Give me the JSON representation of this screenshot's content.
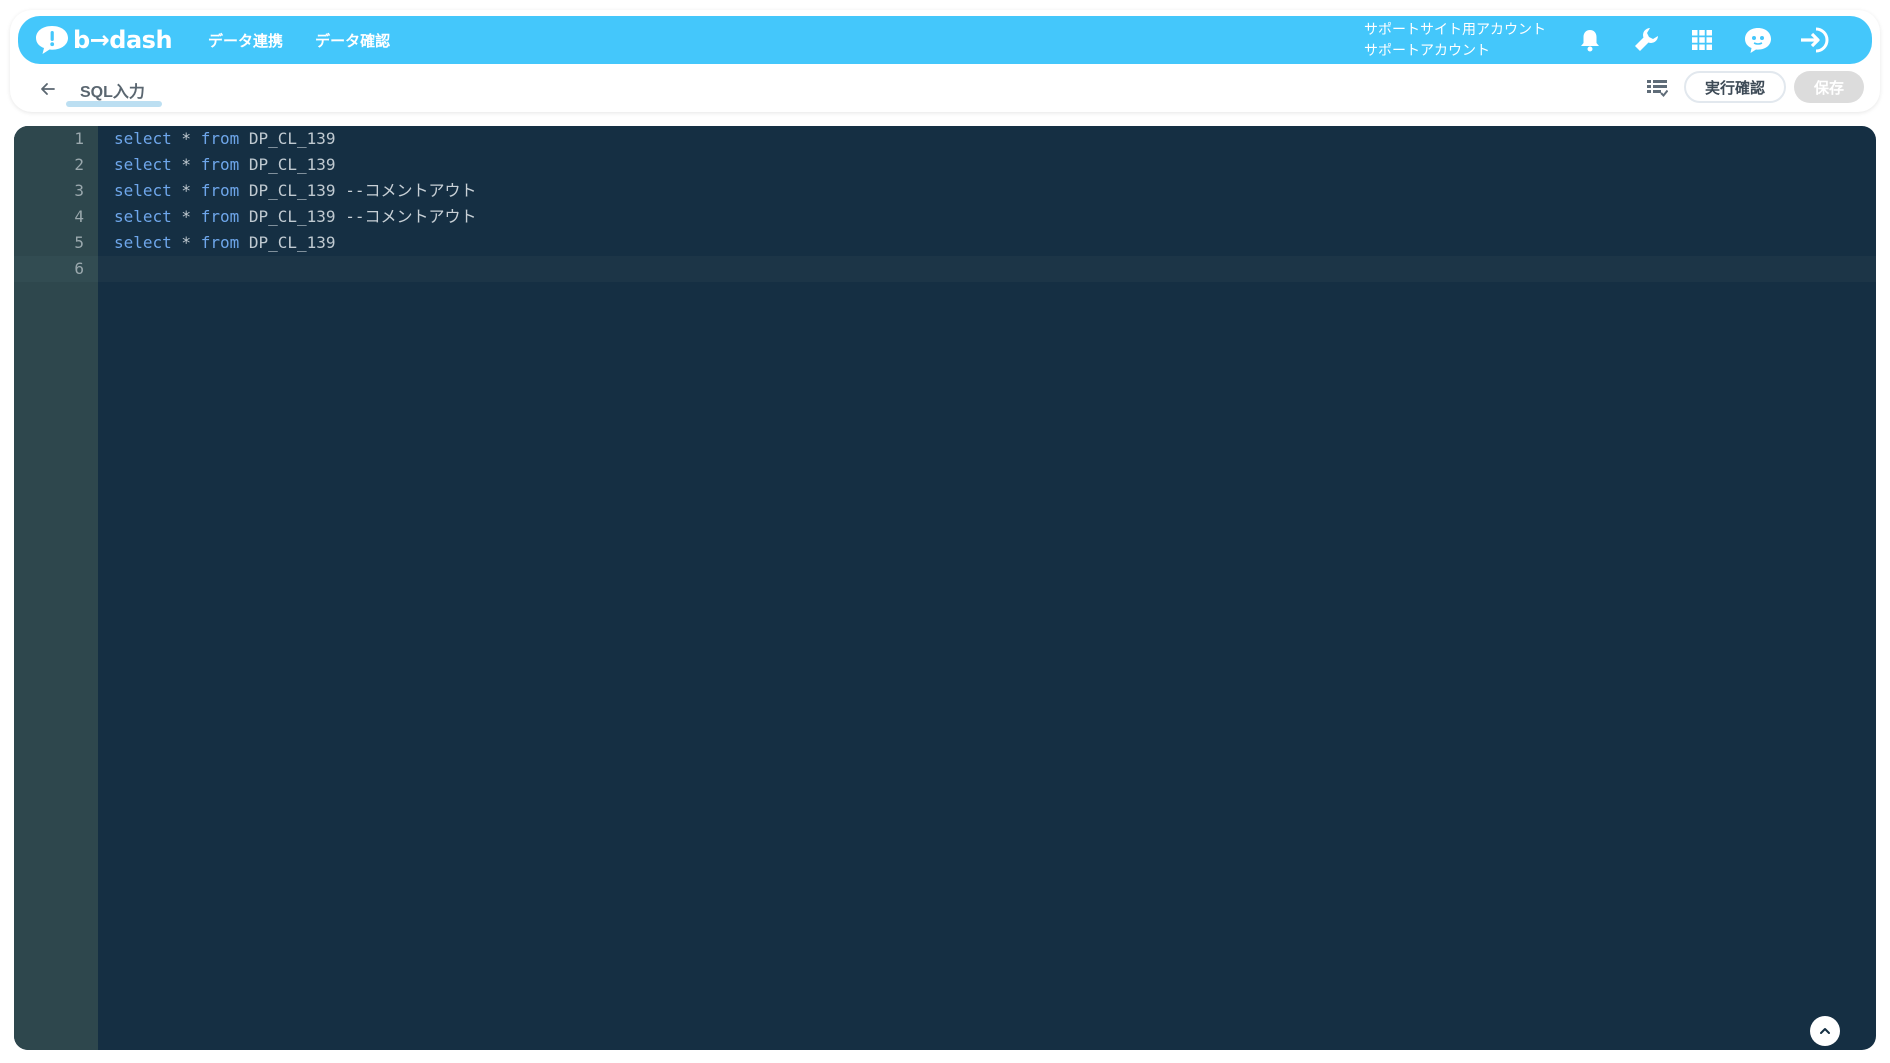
{
  "app": {
    "logo_text": "b→dash",
    "nav": [
      {
        "label": "データ連携"
      },
      {
        "label": "データ確認"
      }
    ],
    "account": {
      "site_account": "サポートサイト用アカウント",
      "user_name": "サポートアカウント"
    },
    "icons": [
      "bell-icon",
      "wrench-icon",
      "apps-grid-icon",
      "chat-bot-icon",
      "logout-icon"
    ],
    "accent_color": "#44c7fb"
  },
  "toolbar": {
    "page_title": "SQL入力",
    "confirm_label": "実行確認",
    "save_label": "保存"
  },
  "editor": {
    "lines": [
      {
        "no": "1",
        "kw1": "select",
        "op": " * ",
        "kw2": "from",
        "table": " DP_CL_139",
        "comment": ""
      },
      {
        "no": "2",
        "kw1": "select",
        "op": " * ",
        "kw2": "from",
        "table": " DP_CL_139",
        "comment": ""
      },
      {
        "no": "3",
        "kw1": "select",
        "op": " * ",
        "kw2": "from",
        "table": " DP_CL_139",
        "comment": " --コメントアウト"
      },
      {
        "no": "4",
        "kw1": "select",
        "op": " * ",
        "kw2": "from",
        "table": " DP_CL_139",
        "comment": " --コメントアウト"
      },
      {
        "no": "5",
        "kw1": "select",
        "op": " * ",
        "kw2": "from",
        "table": " DP_CL_139",
        "comment": ""
      },
      {
        "no": "6",
        "kw1": "",
        "op": "",
        "kw2": "",
        "table": "",
        "comment": ""
      }
    ],
    "active_line": "6"
  }
}
